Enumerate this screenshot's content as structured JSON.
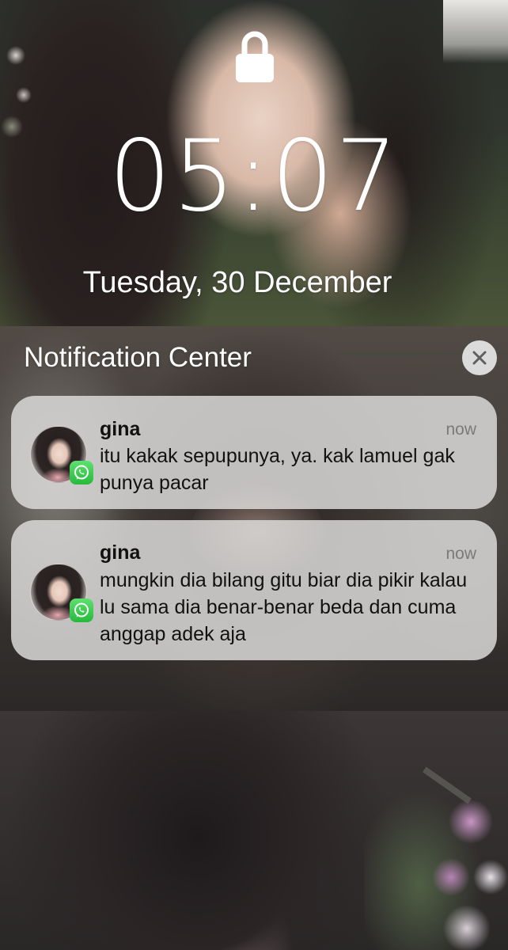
{
  "lock_screen": {
    "time": "05:07",
    "date": "Tuesday, 30 December",
    "lock_icon": "padlock-icon"
  },
  "notification_center": {
    "title": "Notification Center",
    "clear_icon": "close-icon"
  },
  "notifications": [
    {
      "sender": "gina",
      "time": "now",
      "message": "itu kakak sepupunya, ya. kak lamuel gak punya pacar",
      "app_icon": "whatsapp-icon"
    },
    {
      "sender": "gina",
      "time": "now",
      "message": "mungkin dia bilang gitu biar dia pikir kalau lu sama dia benar-benar beda dan cuma anggap adek aja",
      "app_icon": "whatsapp-icon"
    }
  ],
  "colors": {
    "whatsapp_green": "#26b93c",
    "card_background": "#dad9d7",
    "text_primary": "#111111",
    "text_secondary": "#7a7a7a"
  }
}
